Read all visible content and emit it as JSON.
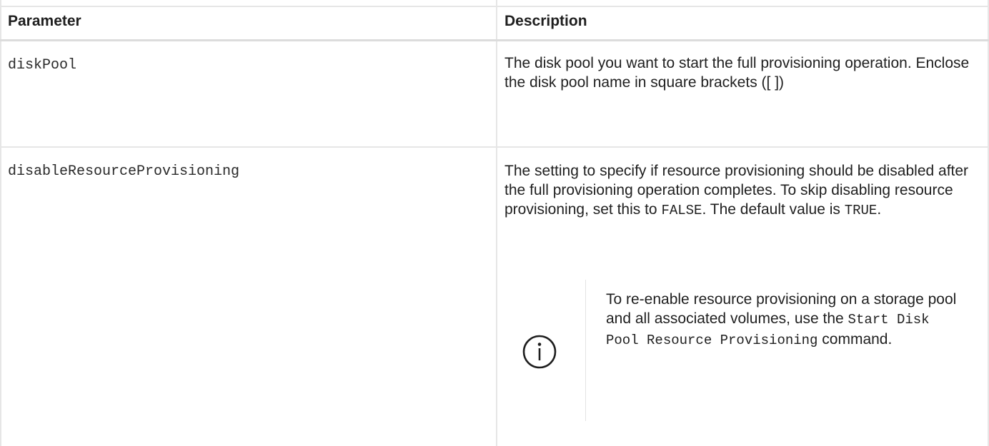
{
  "table": {
    "headers": {
      "parameter": "Parameter",
      "description": "Description"
    },
    "rows": [
      {
        "parameter": "diskPool",
        "description": "The disk pool you want to start the full provisioning operation. Enclose the disk pool name in square brackets ([ ])"
      },
      {
        "parameter": "disableResourceProvisioning",
        "description_part1": "The setting to specify if resource provisioning should be disabled after the full provisioning operation completes. To skip disabling resource provisioning, set this to ",
        "description_code1": "FALSE",
        "description_part2": ". The default value is ",
        "description_code2": "TRUE",
        "description_part3": ".",
        "note": {
          "icon": "info-icon",
          "text_part1": "To re-enable resource provisioning on a storage pool and all associated volumes, use the ",
          "text_code": "Start Disk Pool Resource Provisioning",
          "text_part2": " command."
        }
      }
    ]
  },
  "colors": {
    "border": "#e6e6e6",
    "icon": "#1e1e1e"
  }
}
